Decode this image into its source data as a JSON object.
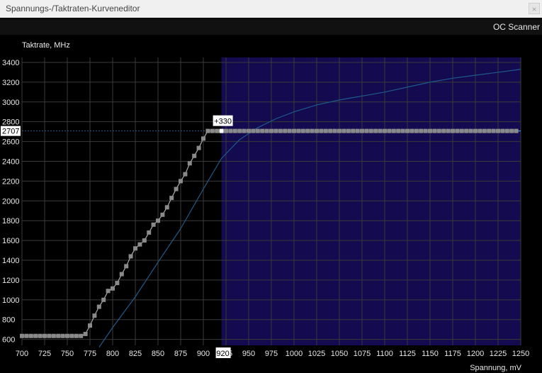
{
  "window": {
    "title": "Spannungs-/Taktraten-Kurveneditor",
    "close_icon": "close-icon"
  },
  "toolbar": {
    "oc_scanner_label": "OC Scanner"
  },
  "chart_data": {
    "type": "line",
    "ylabel": "Taktrate, MHz",
    "xlabel": "Spannung, mV",
    "xlim": [
      700,
      1250
    ],
    "ylim": [
      540,
      3450
    ],
    "x_ticks": [
      "700",
      "725",
      "750",
      "775",
      "800",
      "825",
      "850",
      "875",
      "900",
      "920",
      "925",
      "950",
      "975",
      "1000",
      "1025",
      "1050",
      "1075",
      "1100",
      "1125",
      "1150",
      "1175",
      "1200",
      "1225",
      "1250"
    ],
    "y_ticks": [
      "600",
      "800",
      "1000",
      "1200",
      "1400",
      "1600",
      "1800",
      "2000",
      "2200",
      "2400",
      "2600",
      "2800",
      "3000",
      "3200",
      "3400"
    ],
    "selected_point": {
      "voltage": 920,
      "clock": 2707,
      "offset_label": "+330",
      "clock_label": "2707",
      "voltage_label": "920"
    },
    "highlight_region_start": 920,
    "curve_color": "#a9a9a9",
    "point_color": "#8a8a8a",
    "baseline_color": "#1f5a8c",
    "limit_line_color": "#3da0ff",
    "region_color": "#130a50",
    "series": [
      {
        "name": "",
        "role": "edited-curve",
        "x": [
          700,
          705,
          710,
          715,
          720,
          725,
          730,
          735,
          740,
          745,
          750,
          755,
          760,
          765,
          770,
          775,
          780,
          785,
          790,
          795,
          800,
          805,
          810,
          815,
          820,
          825,
          830,
          835,
          840,
          845,
          850,
          855,
          860,
          865,
          870,
          875,
          880,
          885,
          890,
          895,
          900,
          905,
          910,
          915,
          920
        ],
        "y": [
          635,
          635,
          635,
          635,
          635,
          635,
          635,
          635,
          635,
          635,
          635,
          635,
          635,
          635,
          655,
          740,
          840,
          930,
          1000,
          1090,
          1115,
          1170,
          1260,
          1340,
          1440,
          1520,
          1560,
          1600,
          1680,
          1760,
          1800,
          1860,
          1935,
          2030,
          2120,
          2200,
          2270,
          2380,
          2455,
          2535,
          2630,
          2707,
          2707,
          2707,
          2707
        ]
      },
      {
        "name": "",
        "role": "baseline-curve",
        "x": [
          785,
          800,
          825,
          850,
          875,
          900,
          920,
          940,
          960,
          980,
          1000,
          1025,
          1050,
          1075,
          1100,
          1125,
          1150,
          1175,
          1200,
          1225,
          1250
        ],
        "y": [
          520,
          720,
          1030,
          1380,
          1720,
          2120,
          2430,
          2620,
          2740,
          2830,
          2900,
          2970,
          3020,
          3060,
          3100,
          3150,
          3200,
          3240,
          3270,
          3300,
          3330
        ]
      },
      {
        "name": "",
        "role": "flat-limit",
        "x": [
          920,
          1250
        ],
        "y": [
          2707,
          2707
        ]
      }
    ]
  }
}
